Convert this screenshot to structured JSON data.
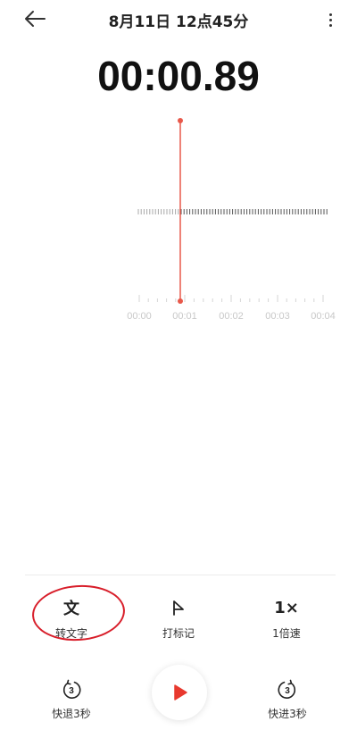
{
  "header": {
    "title": "8月11日 12点45分",
    "back_icon": "arrow-left-icon",
    "more_icon": "more-vertical-icon"
  },
  "timer": "00:00.89",
  "timeline": {
    "ticks": [
      "00:00",
      "00:01",
      "00:02",
      "00:03",
      "00:04"
    ],
    "accent_color": "#e8584a"
  },
  "tools": {
    "transcribe": {
      "icon": "文",
      "label": "转文字"
    },
    "mark": {
      "label": "打标记"
    },
    "speed": {
      "icon": "1×",
      "label": "1倍速"
    }
  },
  "controls": {
    "rewind": {
      "icon_num": "3",
      "label": "快退3秒"
    },
    "forward": {
      "icon_num": "3",
      "label": "快进3秒"
    },
    "play_color": "#e8392e"
  },
  "annotation_color": "#d81e2a"
}
